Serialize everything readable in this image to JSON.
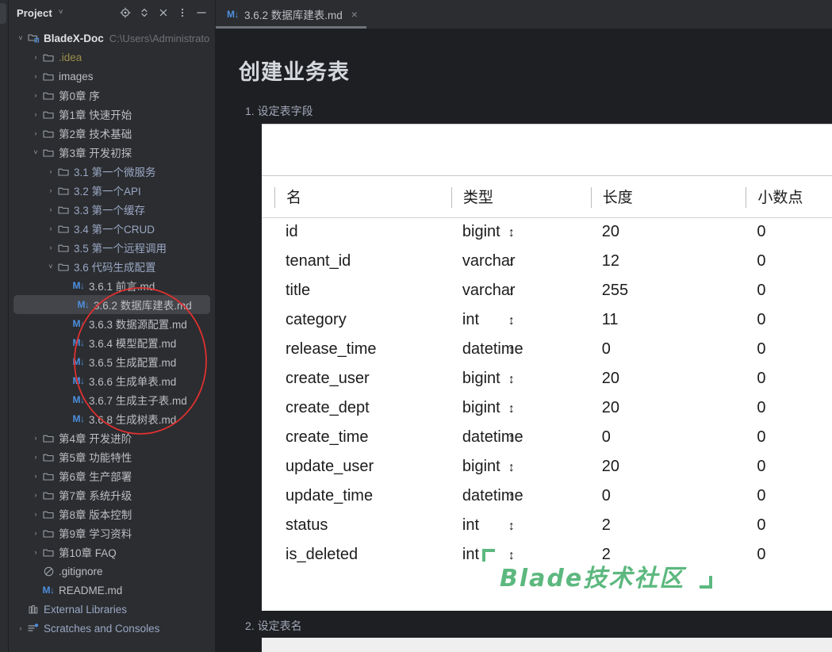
{
  "panel": {
    "title": "Project",
    "chevron": "˅",
    "icons": [
      {
        "name": "locate-icon",
        "label": "Select Opened File"
      },
      {
        "name": "expand-collapse-icon",
        "label": "Expand/Collapse"
      },
      {
        "name": "collapse-all-icon",
        "label": "Collapse All"
      },
      {
        "name": "more-options-icon",
        "label": "Options"
      },
      {
        "name": "hide-icon",
        "label": "Hide"
      }
    ]
  },
  "tree": [
    {
      "indent": 0,
      "arrow": "˅",
      "icon": "module-icon",
      "label": "BladeX-Doc",
      "bold": true,
      "hint": "C:\\Users\\Administrato"
    },
    {
      "indent": 1,
      "arrow": "›",
      "icon": "folder-icon",
      "label": ".idea",
      "color": "yellow"
    },
    {
      "indent": 1,
      "arrow": "›",
      "icon": "folder-icon",
      "label": "images"
    },
    {
      "indent": 1,
      "arrow": "›",
      "icon": "folder-icon",
      "label": "第0章 序"
    },
    {
      "indent": 1,
      "arrow": "›",
      "icon": "folder-icon",
      "label": "第1章 快速开始"
    },
    {
      "indent": 1,
      "arrow": "›",
      "icon": "folder-icon",
      "label": "第2章 技术基础"
    },
    {
      "indent": 1,
      "arrow": "˅",
      "icon": "folder-icon",
      "label": "第3章 开发初探"
    },
    {
      "indent": 2,
      "arrow": "›",
      "icon": "folder-icon",
      "label": "3.1 第一个微服务",
      "color": "link"
    },
    {
      "indent": 2,
      "arrow": "›",
      "icon": "folder-icon",
      "label": "3.2 第一个API",
      "color": "link"
    },
    {
      "indent": 2,
      "arrow": "›",
      "icon": "folder-icon",
      "label": "3.3 第一个缓存",
      "color": "link"
    },
    {
      "indent": 2,
      "arrow": "›",
      "icon": "folder-icon",
      "label": "3.4 第一个CRUD",
      "color": "link"
    },
    {
      "indent": 2,
      "arrow": "›",
      "icon": "folder-icon",
      "label": "3.5 第一个远程调用",
      "color": "link"
    },
    {
      "indent": 2,
      "arrow": "˅",
      "icon": "folder-icon",
      "label": "3.6 代码生成配置",
      "color": "link"
    },
    {
      "indent": 3,
      "arrow": "",
      "icon": "markdown-icon",
      "label": "3.6.1 前言.md"
    },
    {
      "indent": 3,
      "arrow": "",
      "icon": "markdown-icon",
      "label": "3.6.2 数据库建表.md",
      "selected": true
    },
    {
      "indent": 3,
      "arrow": "",
      "icon": "markdown-icon",
      "label": "3.6.3 数据源配置.md"
    },
    {
      "indent": 3,
      "arrow": "",
      "icon": "markdown-icon",
      "label": "3.6.4 模型配置.md"
    },
    {
      "indent": 3,
      "arrow": "",
      "icon": "markdown-icon",
      "label": "3.6.5 生成配置.md"
    },
    {
      "indent": 3,
      "arrow": "",
      "icon": "markdown-icon",
      "label": "3.6.6 生成单表.md"
    },
    {
      "indent": 3,
      "arrow": "",
      "icon": "markdown-icon",
      "label": "3.6.7 生成主子表.md"
    },
    {
      "indent": 3,
      "arrow": "",
      "icon": "markdown-icon",
      "label": "3.6.8 生成树表.md"
    },
    {
      "indent": 1,
      "arrow": "›",
      "icon": "folder-icon",
      "label": "第4章 开发进阶"
    },
    {
      "indent": 1,
      "arrow": "›",
      "icon": "folder-icon",
      "label": "第5章 功能特性"
    },
    {
      "indent": 1,
      "arrow": "›",
      "icon": "folder-icon",
      "label": "第6章 生产部署"
    },
    {
      "indent": 1,
      "arrow": "›",
      "icon": "folder-icon",
      "label": "第7章 系统升级"
    },
    {
      "indent": 1,
      "arrow": "›",
      "icon": "folder-icon",
      "label": "第8章 版本控制"
    },
    {
      "indent": 1,
      "arrow": "›",
      "icon": "folder-icon",
      "label": "第9章 学习资料"
    },
    {
      "indent": 1,
      "arrow": "›",
      "icon": "folder-icon",
      "label": "第10章 FAQ"
    },
    {
      "indent": 1,
      "arrow": "",
      "icon": "gitignore-icon",
      "label": ".gitignore"
    },
    {
      "indent": 1,
      "arrow": "",
      "icon": "markdown-icon",
      "label": "README.md"
    },
    {
      "indent": 0,
      "arrow": "",
      "icon": "library-icon",
      "label": "External Libraries",
      "color": "link"
    },
    {
      "indent": 0,
      "arrow": "›",
      "icon": "scratches-icon",
      "label": "Scratches and Consoles",
      "color": "link"
    }
  ],
  "annotation": {
    "shape": "ellipse",
    "color": "#e03030"
  },
  "tabs": [
    {
      "icon": "markdown-icon",
      "label": "3.6.2 数据库建表.md",
      "close": "×",
      "active": true
    }
  ],
  "document": {
    "heading": "创建业务表",
    "item1": "1. 设定表字段",
    "item2": "2. 设定表名"
  },
  "table": {
    "columns": [
      "名",
      "类型",
      "长度",
      "小数点"
    ],
    "spinner_glyph": "↕",
    "rows": [
      {
        "name": "id",
        "type": "bigint",
        "length": "20",
        "decimal": "0"
      },
      {
        "name": "tenant_id",
        "type": "varchar",
        "length": "12",
        "decimal": "0"
      },
      {
        "name": "title",
        "type": "varchar",
        "length": "255",
        "decimal": "0"
      },
      {
        "name": "category",
        "type": "int",
        "length": "11",
        "decimal": "0"
      },
      {
        "name": "release_time",
        "type": "datetime",
        "length": "0",
        "decimal": "0"
      },
      {
        "name": "create_user",
        "type": "bigint",
        "length": "20",
        "decimal": "0"
      },
      {
        "name": "create_dept",
        "type": "bigint",
        "length": "20",
        "decimal": "0"
      },
      {
        "name": "create_time",
        "type": "datetime",
        "length": "0",
        "decimal": "0"
      },
      {
        "name": "update_user",
        "type": "bigint",
        "length": "20",
        "decimal": "0"
      },
      {
        "name": "update_time",
        "type": "datetime",
        "length": "0",
        "decimal": "0"
      },
      {
        "name": "status",
        "type": "int",
        "length": "2",
        "decimal": "0"
      },
      {
        "name": "is_deleted",
        "type": "int",
        "length": "2",
        "decimal": "0"
      }
    ]
  },
  "watermark": {
    "text": "Blade技术社区",
    "color": "#5cb87f"
  },
  "colors": {
    "panel_bg": "#2b2d30",
    "editor_bg": "#1e1f22",
    "selection": "#43454a",
    "accent_blue": "#4e8fe0",
    "annotation_red": "#e03030",
    "watermark_green": "#5cb87f"
  }
}
